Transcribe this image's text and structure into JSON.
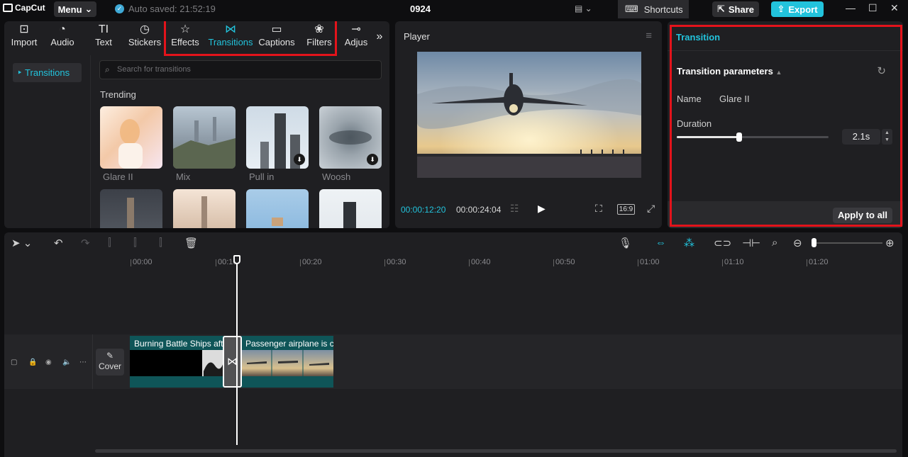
{
  "topbar": {
    "brand": "CapCut",
    "menu_label": "Menu",
    "autosave": "Auto saved: 21:52:19",
    "project_title": "0924",
    "shortcuts_label": "Shortcuts",
    "share_label": "Share",
    "export_label": "Export"
  },
  "media_tabs": [
    {
      "label": "Import",
      "icon": "import-icon"
    },
    {
      "label": "Audio",
      "icon": "audio-icon"
    },
    {
      "label": "Text",
      "icon": "text-icon"
    },
    {
      "label": "Stickers",
      "icon": "stickers-icon"
    },
    {
      "label": "Effects",
      "icon": "effects-icon"
    },
    {
      "label": "Transitions",
      "icon": "transitions-icon"
    },
    {
      "label": "Captions",
      "icon": "captions-icon"
    },
    {
      "label": "Filters",
      "icon": "filters-icon"
    },
    {
      "label": "Adjus",
      "icon": "adjust-icon"
    }
  ],
  "subnav": {
    "item": "Transitions"
  },
  "search": {
    "placeholder": "Search for transitions"
  },
  "trending": {
    "heading": "Trending",
    "items": [
      {
        "label": "Glare II"
      },
      {
        "label": "Mix"
      },
      {
        "label": "Pull in"
      },
      {
        "label": "Woosh"
      }
    ]
  },
  "player": {
    "title": "Player",
    "current_time": "00:00:12:20",
    "duration": "00:00:24:04",
    "ratio": "16:9"
  },
  "transition_panel": {
    "title": "Transition",
    "section": "Transition parameters",
    "name_label": "Name",
    "name_value": "Glare II",
    "duration_label": "Duration",
    "duration_value": "2.1s",
    "duration_fraction": 0.41,
    "apply_all": "Apply to all"
  },
  "timeline": {
    "ruler": [
      "00:00",
      "00:10",
      "00:20",
      "00:30",
      "00:40",
      "00:50",
      "01:00",
      "01:10",
      "01:20"
    ],
    "cover_label": "Cover",
    "clips": [
      {
        "label": "Burning Battle Ships aft"
      },
      {
        "label": "Passenger airplane is cl"
      }
    ]
  },
  "colors": {
    "accent": "#22c3dc",
    "highlight_border": "#e3131b",
    "clip_fill": "#0f5558"
  }
}
